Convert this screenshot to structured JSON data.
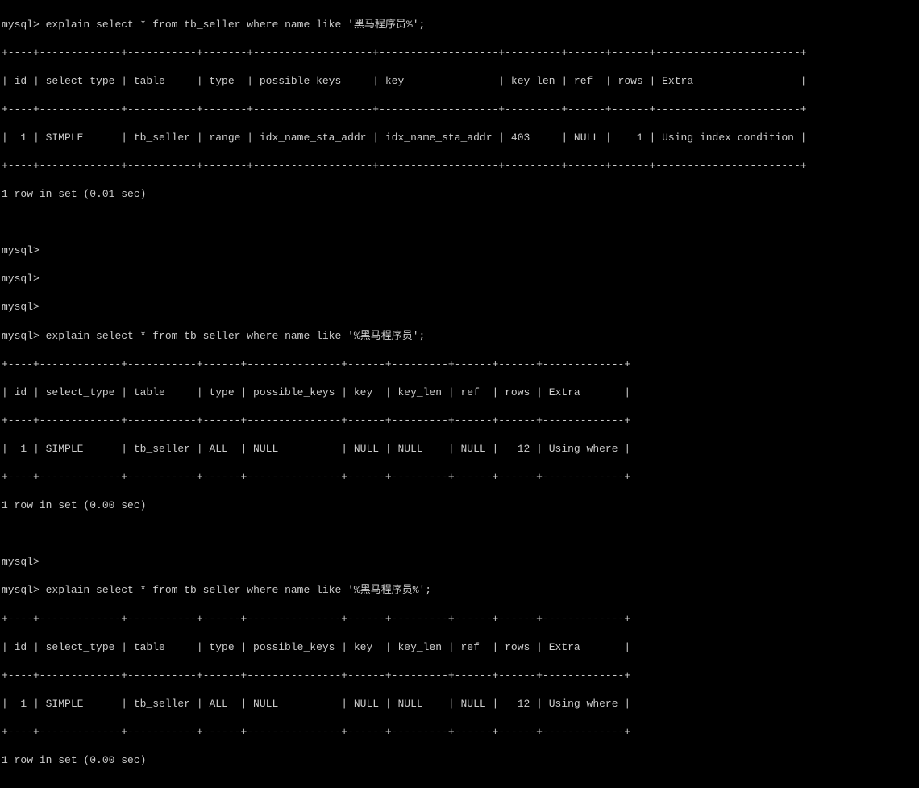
{
  "prompt": "mysql>",
  "blank_prompt": "mysql> ",
  "queries": {
    "q1": "explain select * from tb_seller where name like '黑马程序员%';",
    "q2": "explain select * from tb_seller where name like '%黑马程序员';",
    "q3": "explain select * from tb_seller where name like '%黑马程序员%';"
  },
  "table1": {
    "border": "+----+-------------+-----------+-------+-------------------+-------------------+---------+------+------+-----------------------+",
    "header": "| id | select_type | table     | type  | possible_keys     | key               | key_len | ref  | rows | Extra                 |",
    "row": "|  1 | SIMPLE      | tb_seller | range | idx_name_sta_addr | idx_name_sta_addr | 403     | NULL |    1 | Using index condition |",
    "footer": "1 row in set (0.01 sec)"
  },
  "table2": {
    "border": "+----+-------------+-----------+------+---------------+------+---------+------+------+-------------+",
    "header": "| id | select_type | table     | type | possible_keys | key  | key_len | ref  | rows | Extra       |",
    "row": "|  1 | SIMPLE      | tb_seller | ALL  | NULL          | NULL | NULL    | NULL |   12 | Using where |",
    "footer": "1 row in set (0.00 sec)"
  },
  "table3": {
    "border": "+----+-------------+-----------+------+---------------+------+---------+------+------+-------------+",
    "header": "| id | select_type | table     | type | possible_keys | key  | key_len | ref  | rows | Extra       |",
    "row": "|  1 | SIMPLE      | tb_seller | ALL  | NULL          | NULL | NULL    | NULL |   12 | Using where |",
    "footer": "1 row in set (0.00 sec)"
  }
}
